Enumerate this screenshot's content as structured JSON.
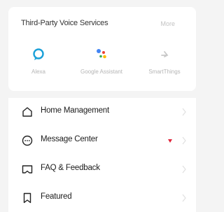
{
  "voice_services": {
    "title": "Third-Party Voice Services",
    "more_label": "More",
    "services": [
      {
        "label": "Alexa",
        "icon": "alexa-icon",
        "color": "#1aa0d8"
      },
      {
        "label": "Google Assistant",
        "icon": "google-assistant-icon",
        "color": "#4285f4"
      },
      {
        "label": "SmartThings",
        "icon": "smartthings-icon",
        "color": "#c8c8c8"
      }
    ]
  },
  "menu": {
    "items": [
      {
        "label": "Home Management",
        "icon": "home-icon"
      },
      {
        "label": "Message Center",
        "icon": "message-icon",
        "badge_color": "#e0243a"
      },
      {
        "label": "FAQ & Feedback",
        "icon": "faq-icon"
      },
      {
        "label": "Featured",
        "icon": "bookmark-icon"
      }
    ]
  }
}
